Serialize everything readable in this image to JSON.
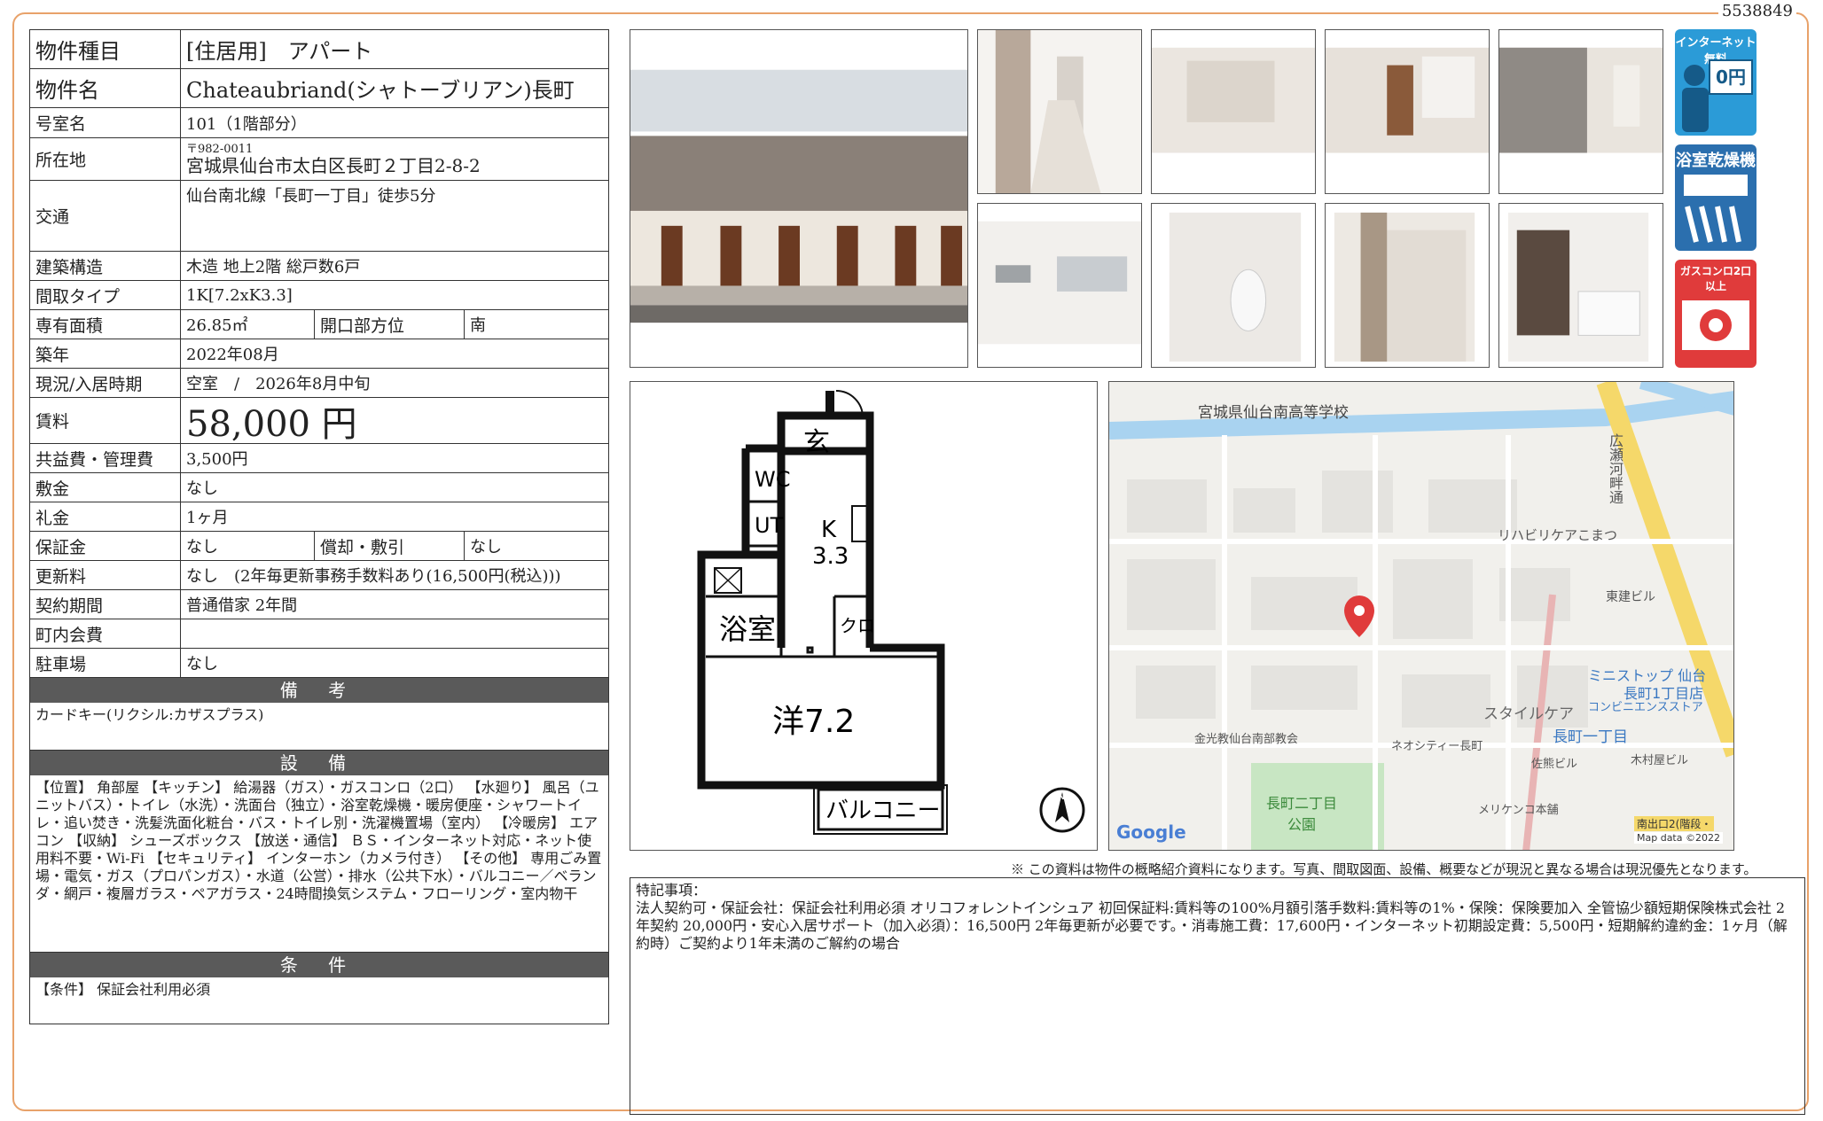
{
  "doc_id": "5538849",
  "table": {
    "type_label": "物件種目",
    "type_value": "[住居用]　アパート",
    "name_label": "物件名",
    "name_value": "Chateaubriand(シャトーブリアン)長町",
    "room_label": "号室名",
    "room_value": "101（1階部分）",
    "address_label": "所在地",
    "zip": "〒982-0011",
    "address": "宮城県仙台市太白区長町２丁目2-8-2",
    "access_label": "交通",
    "access_value": "仙台南北線「長町一丁目」徒歩5分",
    "structure_label": "建築構造",
    "structure_value": "木造 地上2階 総戸数6戸",
    "layout_label": "間取タイプ",
    "layout_value": "1K[7.2xK3.3]",
    "area_label": "専有面積",
    "area_value": "26.85㎡",
    "direction_label": "開口部方位",
    "direction_value": "南",
    "built_label": "築年",
    "built_value": "2022年08月",
    "status_label": "現況/入居時期",
    "status_value": "空室　/　2026年8月中旬",
    "rent_label": "賃料",
    "rent_value": "58,000 円",
    "fee_label": "共益費・管理費",
    "fee_value": "3,500円",
    "deposit_label": "敷金",
    "deposit_value": "なし",
    "keymoney_label": "礼金",
    "keymoney_value": "1ヶ月",
    "guarantee_label": "保証金",
    "guarantee_value": "なし",
    "amort_label": "償却・敷引",
    "amort_value": "なし",
    "renewal_label": "更新料",
    "renewal_value": "なし　(2年毎更新事務手数料あり(16,500円(税込)))",
    "contract_label": "契約期間",
    "contract_value": "普通借家 2年間",
    "town_label": "町内会費",
    "town_value": "",
    "parking_label": "駐車場",
    "parking_value": "なし"
  },
  "sections": {
    "remarks_head": "備 考",
    "remarks_body": "カードキー(リクシル:カザスプラス)",
    "equipment_head": "設 備",
    "equipment_body": "【位置】 角部屋 【キッチン】 給湯器（ガス）・ガスコンロ（2口） 【水廻り】 風呂（ユニットバス）・トイレ（水洗）・洗面台（独立）・浴室乾燥機・暖房便座・シャワートイレ・追い焚き・洗髪洗面化粧台・バス・トイレ別・洗濯機置場（室内） 【冷暖房】 エアコン 【収納】 シューズボックス 【放送・通信】 ＢＳ・インターネット対応・ネット使用料不要・Wi-Fi 【セキュリティ】 インターホン（カメラ付き） 【その他】 専用ごみ置場・電気・ガス（プロパンガス）・水道（公営）・排水（公共下水）・バルコニー／ベランダ・網戸・複層ガラス・ペアガラス・24時間換気システム・フローリング・室内物干",
    "conditions_head": "条 件",
    "conditions_body": "【条件】 保証会社利用必須"
  },
  "badges": {
    "internet": "インターネット無料",
    "internet_price": "0円",
    "bath": "浴室乾燥機",
    "gas": "ガスコンロ2口以上"
  },
  "floorplan": {
    "entrance": "玄",
    "wc": "WC",
    "ut": "UT",
    "kitchen": "K",
    "kitchen_size": "3.3",
    "bath": "浴室",
    "closet": "クロ",
    "room": "洋7.2",
    "balcony": "バルコニー",
    "north": "N"
  },
  "map": {
    "school": "宮城県仙台南高等学校",
    "road": "広瀬河畔通",
    "care": "リハビリケアこまつ",
    "tokenbldg": "東建ビル",
    "ministop": "ミニストップ 仙台",
    "ministop2": "長町1丁目店",
    "conv": "コンビニエンスストア",
    "style": "スタイルケア",
    "station": "長町一丁目",
    "church": "金光教仙台南部教会",
    "neocity": "ネオシティー長町",
    "sasaki": "佐熊ビル",
    "kimura": "木村屋ビル",
    "meriken": "メリケンコ本舗",
    "park": "長町二丁目公園",
    "google": "Google",
    "exit": "南出口2(階段・",
    "mapdata": "Map data ©2022"
  },
  "footer": {
    "disclaimer": "※ この資料は物件の概略紹介資料になります。写真、間取図面、設備、概要などが現況と異なる場合は現況優先となります。",
    "special_head": "特記事項：",
    "special_body": "法人契約可・保証会社：保証会社利用必須 オリコフォレントインシュア 初回保証料:賃料等の100%月額引落手数料:賃料等の1%・保険：保険要加入 全管協少額短期保険株式会社 2年契約 20,000円・安心入居サポート（加入必須）：16,500円 2年毎更新が必要です。・消毒施工費：17,600円・インターネット初期設定費：5,500円・短期解約違約金：1ヶ月（解約時）ご契約より1年未満のご解約の場合"
  }
}
